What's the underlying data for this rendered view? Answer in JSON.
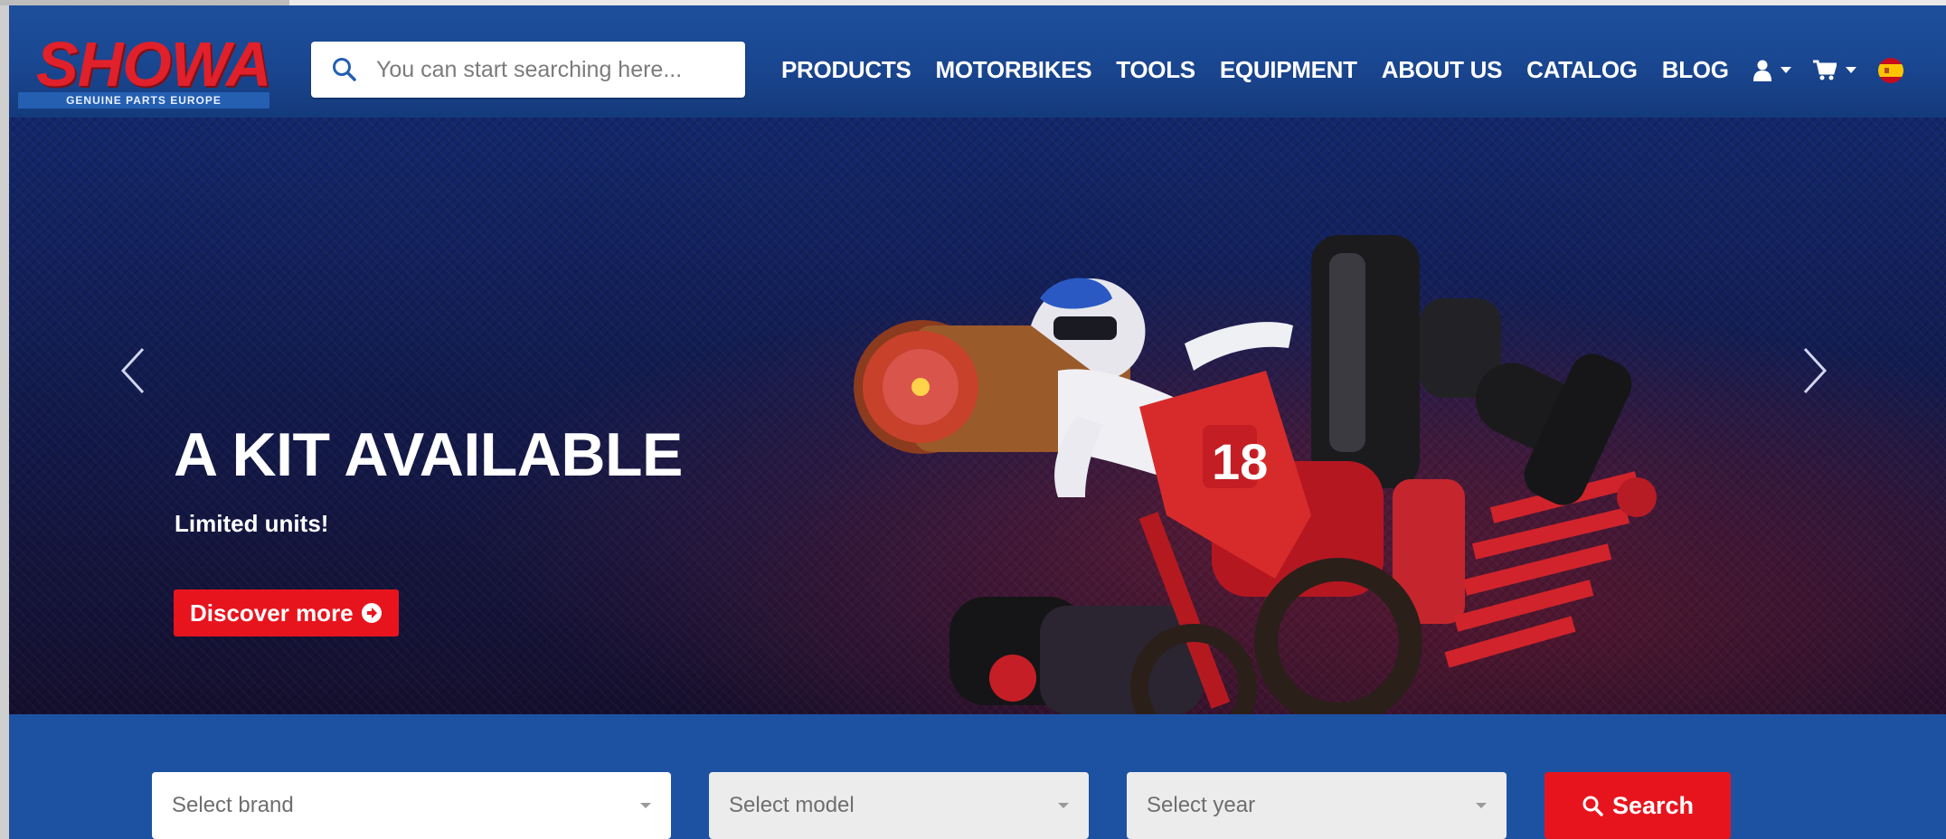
{
  "header": {
    "logo": {
      "brand": "SHOWA",
      "tagline": "GENUINE PARTS EUROPE"
    },
    "search": {
      "placeholder": "You can start searching here..."
    },
    "nav": [
      {
        "label": "PRODUCTS"
      },
      {
        "label": "MOTORBIKES"
      },
      {
        "label": "TOOLS"
      },
      {
        "label": "EQUIPMENT"
      },
      {
        "label": "ABOUT US"
      },
      {
        "label": "CATALOG"
      },
      {
        "label": "BLOG"
      }
    ],
    "icons": [
      "user-icon",
      "cart-icon",
      "spain-flag-icon"
    ]
  },
  "hero": {
    "title": "A KIT AVAILABLE",
    "subtitle": "Limited units!",
    "cta_label": "Discover more",
    "rider_number": "18"
  },
  "filter": {
    "brand_placeholder": "Select brand",
    "model_placeholder": "Select model",
    "year_placeholder": "Select year",
    "search_label": "Search"
  },
  "colors": {
    "header_blue": "#1a4690",
    "accent_red": "#e8141d",
    "filter_blue": "#1d52a3"
  }
}
